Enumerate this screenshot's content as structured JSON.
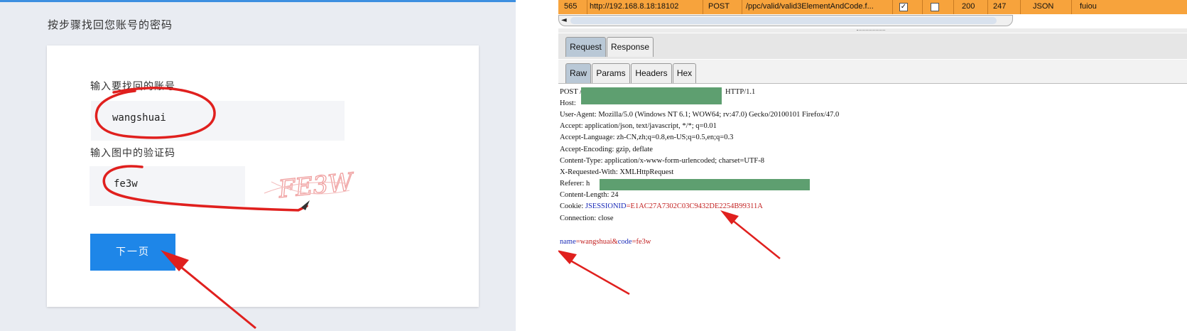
{
  "recovery": {
    "heading": "按步骤找回您账号的密码",
    "account_label": "输入要找回的账号",
    "account_value": "wangshuai",
    "captcha_label": "输入图中的验证码",
    "captcha_value": "fe3w",
    "captcha_image_text": "FE3W",
    "next_label": "下一页"
  },
  "history": {
    "id": "565",
    "host": "http://192.168.8.18:18102",
    "method": "POST",
    "url": "/ppc/valid/valid3ElementAndCode.f...",
    "status": "200",
    "length": "247",
    "mime": "JSON",
    "extension": "fuiou"
  },
  "tabs": {
    "outer": [
      "Request",
      "Response"
    ],
    "inner": [
      "Raw",
      "Params",
      "Headers",
      "Hex"
    ]
  },
  "request": {
    "line1_method": "POST /",
    "line1_proto": "HTTP/1.1",
    "host": "Host:",
    "user_agent": "User-Agent: Mozilla/5.0 (Windows NT 6.1; WOW64; rv:47.0) Gecko/20100101 Firefox/47.0",
    "accept": "Accept: application/json, text/javascript, */*; q=0.01",
    "accept_language": "Accept-Language: zh-CN,zh;q=0.8,en-US;q=0.5,en;q=0.3",
    "accept_encoding": "Accept-Encoding: gzip, deflate",
    "content_type": "Content-Type: application/x-www-form-urlencoded; charset=UTF-8",
    "x_requested_with": "X-Requested-With: XMLHttpRequest",
    "referer": "Referer: h",
    "content_length": "Content-Length: 24",
    "cookie_prefix": "Cookie: ",
    "cookie_name": "JSESSIONID",
    "cookie_value": "=E1AC27A7302C03C9432DE2254B99311A",
    "connection": "Connection: close",
    "body_name_key": "name",
    "body_name_val": "=wangshuai&",
    "body_code_key": "code",
    "body_code_val": "=fe3w"
  },
  "colors": {
    "accent_blue": "#1e86e8",
    "annotation_red": "#e0201e",
    "history_highlight": "#f7a33c",
    "redaction_green": "#5e9f70"
  }
}
